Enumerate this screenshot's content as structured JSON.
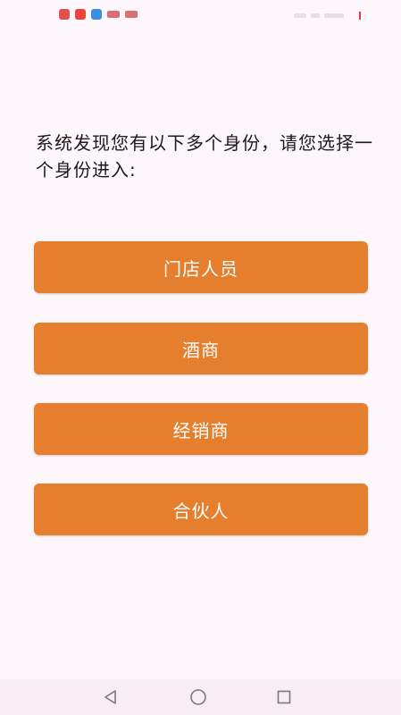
{
  "status_bar": {
    "app_icons": [
      "home-app-icon",
      "store-app-icon",
      "shield-app-icon",
      "logo-app-icon",
      "logo-app-icon"
    ]
  },
  "prompt": {
    "text": "系统发现您有以下多个身份，请您选择一个身份进入:"
  },
  "roles": [
    {
      "label": "门店人员"
    },
    {
      "label": "酒商"
    },
    {
      "label": "经销商"
    },
    {
      "label": "合伙人"
    }
  ],
  "colors": {
    "button": "#e57f2e",
    "button_text": "#ffffff",
    "background": "#fdf6fb"
  },
  "nav": {
    "back": "back-icon",
    "home": "home-icon",
    "recents": "recents-icon"
  }
}
